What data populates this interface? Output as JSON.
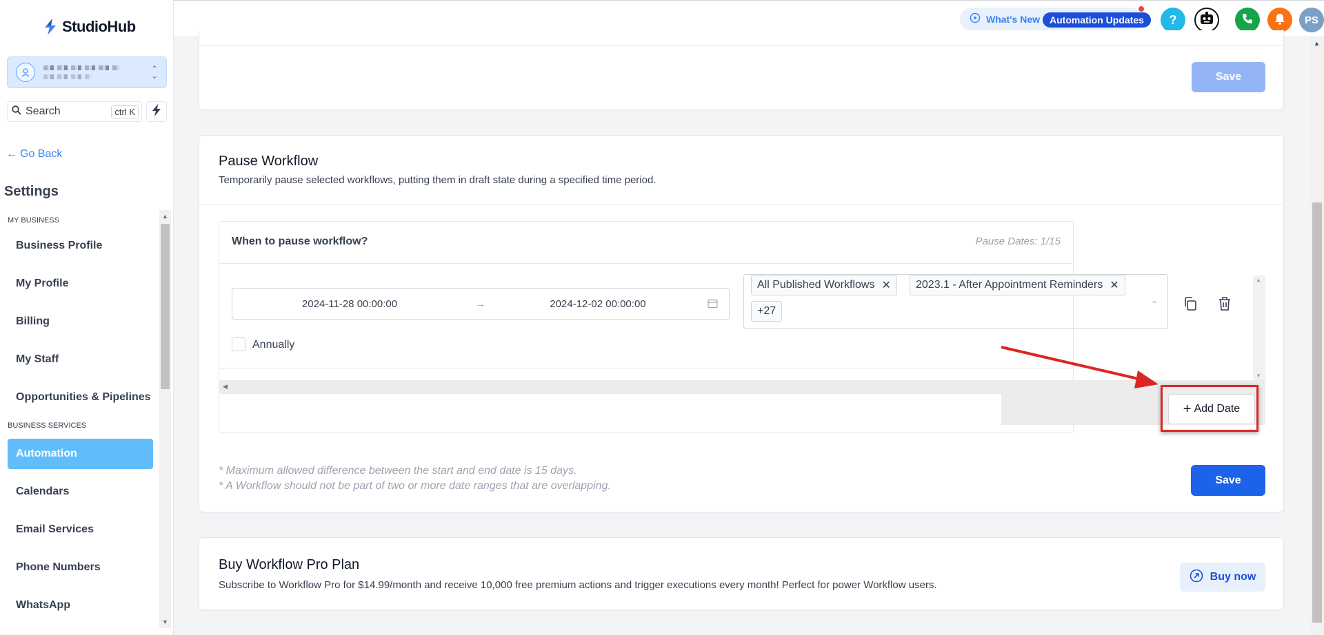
{
  "app": {
    "name": "StudioHub"
  },
  "sidebar": {
    "search_label": "Search",
    "search_shortcut": "ctrl K",
    "go_back": "Go Back",
    "title": "Settings",
    "sections": [
      {
        "label": "MY BUSINESS",
        "items": [
          "Business Profile",
          "My Profile",
          "Billing",
          "My Staff",
          "Opportunities & Pipelines"
        ]
      },
      {
        "label": "BUSINESS SERVICES",
        "items": [
          "Automation",
          "Calendars",
          "Email Services",
          "Phone Numbers",
          "WhatsApp"
        ]
      }
    ],
    "active_item": "Automation"
  },
  "topbar": {
    "whats_new": "What's New",
    "automation_updates": "Automation Updates",
    "help_glyph": "?",
    "avatar_initials": "PS",
    "colors": {
      "help": "#22b8e8",
      "phone": "#16a34a",
      "bell": "#f97316",
      "avatar": "#7aa0c4"
    }
  },
  "top_card": {
    "save_label": "Save"
  },
  "pause_workflow": {
    "title": "Pause Workflow",
    "subtitle": "Temporarily pause selected workflows, putting them in draft state during a specified time period.",
    "question": "When to pause workflow?",
    "pause_dates": "Pause Dates: 1/15",
    "start_date": "2024-11-28 00:00:00",
    "end_date": "2024-12-02 00:00:00",
    "tags": [
      "All Published Workflows",
      "2023.1 - After Appointment Reminders"
    ],
    "more_count": "+27",
    "annually_label": "Annually",
    "add_date_label": "Add Date",
    "notes": [
      "* Maximum allowed difference between the start and end date is 15 days.",
      "* A Workflow should not be part of two or more date ranges that are overlapping."
    ],
    "save_label": "Save"
  },
  "pro_plan": {
    "title": "Buy Workflow Pro Plan",
    "description": "Subscribe to Workflow Pro for $14.99/month and receive 10,000 free premium actions and trigger executions every month! Perfect for power Workflow users.",
    "buy_label": "Buy now"
  }
}
